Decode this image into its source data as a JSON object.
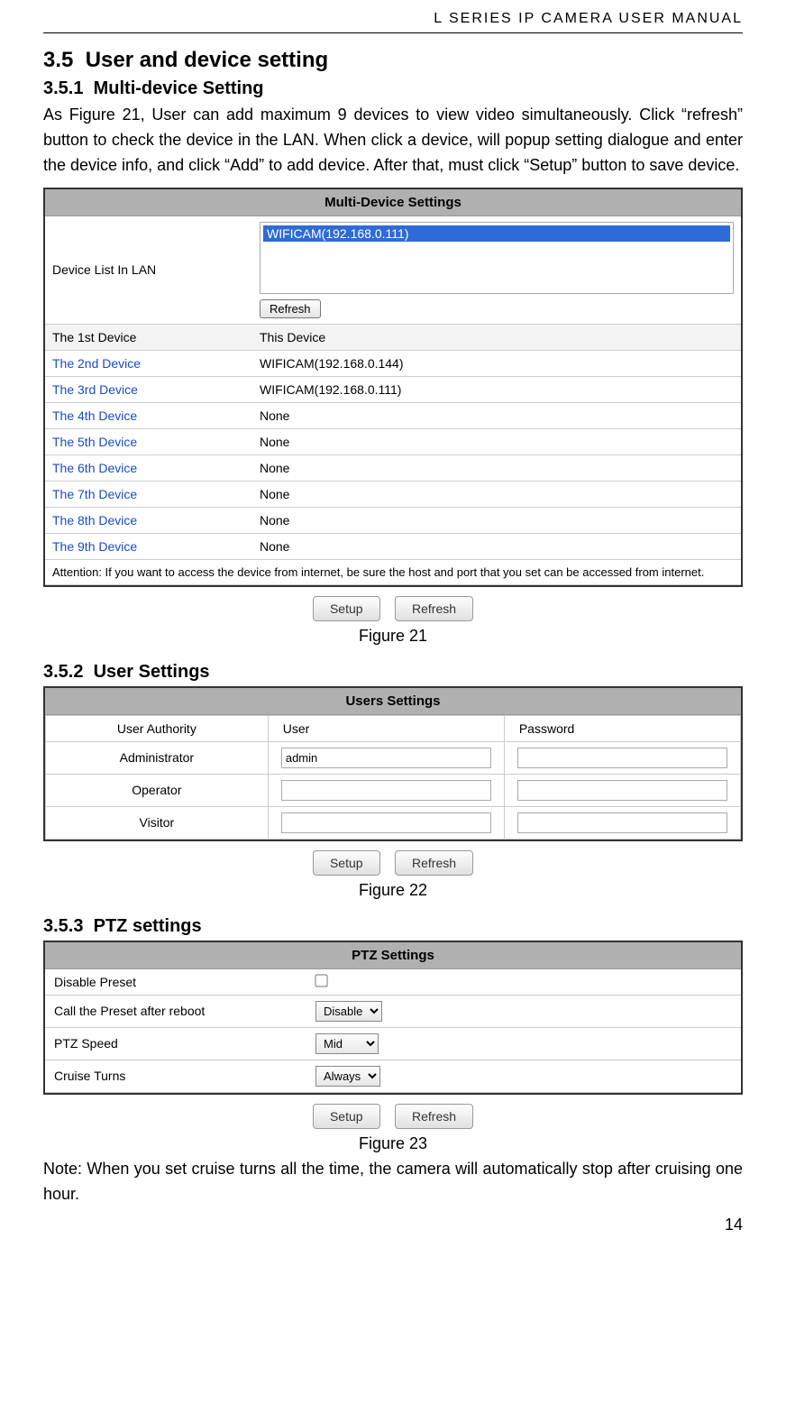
{
  "header": "L  SERIES  IP  CAMERA  USER  MANUAL",
  "section_3_5": {
    "num": "3.5",
    "title": "User and device setting"
  },
  "section_3_5_1": {
    "num": "3.5.1",
    "title": "Multi-device Setting",
    "para": "As Figure 21, User can add maximum 9 devices to view video simultaneously. Click “refresh” button to check the device in the LAN. When click a device, will popup setting dialogue and enter the device info, and click “Add” to add device. After that, must click “Setup” button to save device."
  },
  "multi_device": {
    "title": "Multi-Device Settings",
    "lan_label": "Device List In LAN",
    "lan_item": "WIFICAM(192.168.0.111)",
    "refresh_btn": "Refresh",
    "rows": [
      {
        "label": "The 1st Device",
        "value": "This Device",
        "link": false,
        "shaded": true
      },
      {
        "label": "The 2nd Device",
        "value": "WIFICAM(192.168.0.144)",
        "link": true,
        "shaded": false
      },
      {
        "label": "The 3rd Device",
        "value": "WIFICAM(192.168.0.111)",
        "link": true,
        "shaded": false
      },
      {
        "label": "The 4th Device",
        "value": "None",
        "link": true,
        "shaded": false
      },
      {
        "label": "The 5th Device",
        "value": "None",
        "link": true,
        "shaded": false
      },
      {
        "label": "The 6th Device",
        "value": "None",
        "link": true,
        "shaded": false
      },
      {
        "label": "The 7th Device",
        "value": "None",
        "link": true,
        "shaded": false
      },
      {
        "label": "The 8th Device",
        "value": "None",
        "link": true,
        "shaded": false
      },
      {
        "label": "The 9th Device",
        "value": "None",
        "link": true,
        "shaded": false
      }
    ],
    "attention": "Attention: If you want to access the device from internet, be sure the host and port that you set can be accessed from internet.",
    "setup_btn": "Setup",
    "refresh2_btn": "Refresh",
    "caption": "Figure 21"
  },
  "section_3_5_2": {
    "num": "3.5.2",
    "title": "User Settings"
  },
  "users": {
    "title": "Users Settings",
    "headers": {
      "auth": "User Authority",
      "user": "User",
      "pass": "Password"
    },
    "rows": [
      {
        "role": "Administrator",
        "user": "admin",
        "pass": ""
      },
      {
        "role": "Operator",
        "user": "",
        "pass": ""
      },
      {
        "role": "Visitor",
        "user": "",
        "pass": ""
      }
    ],
    "setup_btn": "Setup",
    "refresh_btn": "Refresh",
    "caption": "Figure 22"
  },
  "section_3_5_3": {
    "num": "3.5.3",
    "title": "PTZ settings"
  },
  "ptz": {
    "title": "PTZ Settings",
    "disable_preset_label": "Disable Preset",
    "disable_preset_checked": false,
    "call_preset_label": "Call the Preset after reboot",
    "call_preset_value": "Disable",
    "speed_label": "PTZ Speed",
    "speed_value": "Mid",
    "cruise_label": "Cruise Turns",
    "cruise_value": "Always",
    "setup_btn": "Setup",
    "refresh_btn": "Refresh",
    "caption": "Figure 23"
  },
  "note": "Note: When you set cruise turns all the time, the camera will automatically stop after cruising one hour.",
  "page_number": "14"
}
